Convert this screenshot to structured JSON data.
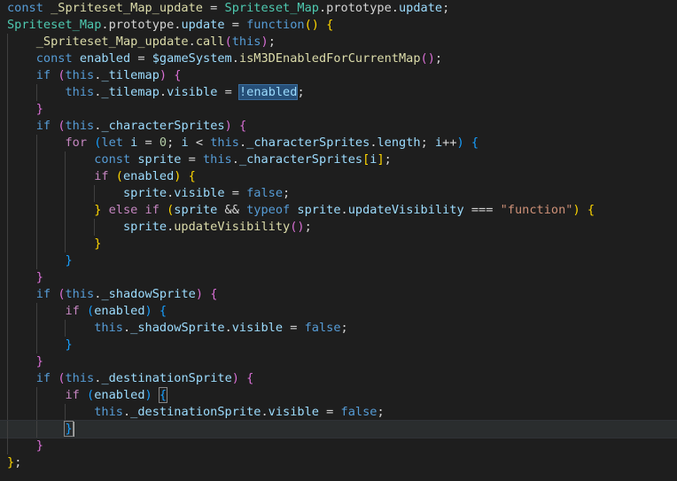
{
  "editor": {
    "language": "javascript",
    "theme_colors": {
      "background": "#1e1e1e",
      "keyword": "#569cd6",
      "class": "#4ec9b0",
      "variable": "#9cdcfe",
      "function": "#dcdcaa",
      "string": "#ce9178",
      "number": "#b5cea8",
      "bracket_1": "#ffd700",
      "bracket_2": "#da70d6",
      "bracket_3": "#179fff",
      "selection": "#264f78"
    },
    "lines": [
      {
        "indent": 0,
        "tokens": [
          {
            "t": "const ",
            "c": "kw"
          },
          {
            "t": "_Spriteset_Map_update",
            "c": "fn"
          },
          {
            "t": " = ",
            "c": "op"
          },
          {
            "t": "Spriteset_Map",
            "c": "cls"
          },
          {
            "t": ".prototype.",
            "c": "plain"
          },
          {
            "t": "update",
            "c": "var"
          },
          {
            "t": ";",
            "c": "op"
          }
        ]
      },
      {
        "indent": 0,
        "tokens": [
          {
            "t": "Spriteset_Map",
            "c": "cls"
          },
          {
            "t": ".prototype.",
            "c": "plain"
          },
          {
            "t": "update",
            "c": "var"
          },
          {
            "t": " = ",
            "c": "op"
          },
          {
            "t": "function",
            "c": "kw"
          },
          {
            "t": "()",
            "c": "b1"
          },
          {
            "t": " ",
            "c": "op"
          },
          {
            "t": "{",
            "c": "b1"
          }
        ]
      },
      {
        "indent": 1,
        "tokens": [
          {
            "t": "_Spriteset_Map_update",
            "c": "fn"
          },
          {
            "t": ".",
            "c": "plain"
          },
          {
            "t": "call",
            "c": "fn"
          },
          {
            "t": "(",
            "c": "b2"
          },
          {
            "t": "this",
            "c": "kw"
          },
          {
            "t": ")",
            "c": "b2"
          },
          {
            "t": ";",
            "c": "op"
          }
        ]
      },
      {
        "indent": 1,
        "tokens": [
          {
            "t": "const ",
            "c": "kw"
          },
          {
            "t": "enabled",
            "c": "var"
          },
          {
            "t": " = ",
            "c": "op"
          },
          {
            "t": "$gameSystem",
            "c": "var"
          },
          {
            "t": ".",
            "c": "plain"
          },
          {
            "t": "isM3DEnabledForCurrentMap",
            "c": "fn"
          },
          {
            "t": "()",
            "c": "b2"
          },
          {
            "t": ";",
            "c": "op"
          }
        ]
      },
      {
        "indent": 1,
        "tokens": [
          {
            "t": "if ",
            "c": "kw"
          },
          {
            "t": "(",
            "c": "b2"
          },
          {
            "t": "this",
            "c": "kw"
          },
          {
            "t": ".",
            "c": "plain"
          },
          {
            "t": "_tilemap",
            "c": "var"
          },
          {
            "t": ")",
            "c": "b2"
          },
          {
            "t": " ",
            "c": "op"
          },
          {
            "t": "{",
            "c": "b2"
          }
        ]
      },
      {
        "indent": 2,
        "tokens": [
          {
            "t": "this",
            "c": "kw"
          },
          {
            "t": ".",
            "c": "plain"
          },
          {
            "t": "_tilemap",
            "c": "var"
          },
          {
            "t": ".",
            "c": "plain"
          },
          {
            "t": "visible",
            "c": "var"
          },
          {
            "t": " = ",
            "c": "op"
          },
          {
            "t": "!enabled",
            "c": "var",
            "sel": true
          },
          {
            "t": ";",
            "c": "op"
          }
        ]
      },
      {
        "indent": 1,
        "tokens": [
          {
            "t": "}",
            "c": "b2"
          }
        ]
      },
      {
        "indent": 1,
        "tokens": [
          {
            "t": "if ",
            "c": "kw"
          },
          {
            "t": "(",
            "c": "b2"
          },
          {
            "t": "this",
            "c": "kw"
          },
          {
            "t": ".",
            "c": "plain"
          },
          {
            "t": "_characterSprites",
            "c": "var"
          },
          {
            "t": ")",
            "c": "b2"
          },
          {
            "t": " ",
            "c": "op"
          },
          {
            "t": "{",
            "c": "b2"
          }
        ]
      },
      {
        "indent": 2,
        "tokens": [
          {
            "t": "for ",
            "c": "kwc"
          },
          {
            "t": "(",
            "c": "b3"
          },
          {
            "t": "let ",
            "c": "kw"
          },
          {
            "t": "i",
            "c": "var"
          },
          {
            "t": " = ",
            "c": "op"
          },
          {
            "t": "0",
            "c": "num"
          },
          {
            "t": "; ",
            "c": "op"
          },
          {
            "t": "i",
            "c": "var"
          },
          {
            "t": " < ",
            "c": "op"
          },
          {
            "t": "this",
            "c": "kw"
          },
          {
            "t": ".",
            "c": "plain"
          },
          {
            "t": "_characterSprites",
            "c": "var"
          },
          {
            "t": ".",
            "c": "plain"
          },
          {
            "t": "length",
            "c": "var"
          },
          {
            "t": "; ",
            "c": "op"
          },
          {
            "t": "i",
            "c": "var"
          },
          {
            "t": "++",
            "c": "op"
          },
          {
            "t": ")",
            "c": "b3"
          },
          {
            "t": " ",
            "c": "op"
          },
          {
            "t": "{",
            "c": "b3"
          }
        ]
      },
      {
        "indent": 3,
        "tokens": [
          {
            "t": "const ",
            "c": "kw"
          },
          {
            "t": "sprite",
            "c": "var"
          },
          {
            "t": " = ",
            "c": "op"
          },
          {
            "t": "this",
            "c": "kw"
          },
          {
            "t": ".",
            "c": "plain"
          },
          {
            "t": "_characterSprites",
            "c": "var"
          },
          {
            "t": "[",
            "c": "b1"
          },
          {
            "t": "i",
            "c": "var"
          },
          {
            "t": "]",
            "c": "b1"
          },
          {
            "t": ";",
            "c": "op"
          }
        ]
      },
      {
        "indent": 3,
        "tokens": [
          {
            "t": "if ",
            "c": "kwc"
          },
          {
            "t": "(",
            "c": "b1"
          },
          {
            "t": "enabled",
            "c": "var"
          },
          {
            "t": ")",
            "c": "b1"
          },
          {
            "t": " ",
            "c": "op"
          },
          {
            "t": "{",
            "c": "b1"
          }
        ]
      },
      {
        "indent": 4,
        "tokens": [
          {
            "t": "sprite",
            "c": "var"
          },
          {
            "t": ".",
            "c": "plain"
          },
          {
            "t": "visible",
            "c": "var"
          },
          {
            "t": " = ",
            "c": "op"
          },
          {
            "t": "false",
            "c": "kw"
          },
          {
            "t": ";",
            "c": "op"
          }
        ]
      },
      {
        "indent": 3,
        "tokens": [
          {
            "t": "}",
            "c": "b1"
          },
          {
            "t": " ",
            "c": "op"
          },
          {
            "t": "else ",
            "c": "kwc"
          },
          {
            "t": "if ",
            "c": "kwc"
          },
          {
            "t": "(",
            "c": "b1"
          },
          {
            "t": "sprite",
            "c": "var"
          },
          {
            "t": " && ",
            "c": "op"
          },
          {
            "t": "typeof ",
            "c": "kw"
          },
          {
            "t": "sprite",
            "c": "var"
          },
          {
            "t": ".",
            "c": "plain"
          },
          {
            "t": "updateVisibility",
            "c": "var"
          },
          {
            "t": " === ",
            "c": "op"
          },
          {
            "t": "\"function\"",
            "c": "str"
          },
          {
            "t": ")",
            "c": "b1"
          },
          {
            "t": " ",
            "c": "op"
          },
          {
            "t": "{",
            "c": "b1"
          }
        ]
      },
      {
        "indent": 4,
        "tokens": [
          {
            "t": "sprite",
            "c": "var"
          },
          {
            "t": ".",
            "c": "plain"
          },
          {
            "t": "updateVisibility",
            "c": "fn"
          },
          {
            "t": "()",
            "c": "b2"
          },
          {
            "t": ";",
            "c": "op"
          }
        ]
      },
      {
        "indent": 3,
        "tokens": [
          {
            "t": "}",
            "c": "b1"
          }
        ]
      },
      {
        "indent": 2,
        "tokens": [
          {
            "t": "}",
            "c": "b3"
          }
        ]
      },
      {
        "indent": 1,
        "tokens": [
          {
            "t": "}",
            "c": "b2"
          }
        ]
      },
      {
        "indent": 1,
        "tokens": [
          {
            "t": "if ",
            "c": "kw"
          },
          {
            "t": "(",
            "c": "b2"
          },
          {
            "t": "this",
            "c": "kw"
          },
          {
            "t": ".",
            "c": "plain"
          },
          {
            "t": "_shadowSprite",
            "c": "var"
          },
          {
            "t": ")",
            "c": "b2"
          },
          {
            "t": " ",
            "c": "op"
          },
          {
            "t": "{",
            "c": "b2"
          }
        ]
      },
      {
        "indent": 2,
        "tokens": [
          {
            "t": "if ",
            "c": "kwc"
          },
          {
            "t": "(",
            "c": "b3"
          },
          {
            "t": "enabled",
            "c": "var"
          },
          {
            "t": ")",
            "c": "b3"
          },
          {
            "t": " ",
            "c": "op"
          },
          {
            "t": "{",
            "c": "b3"
          }
        ]
      },
      {
        "indent": 3,
        "tokens": [
          {
            "t": "this",
            "c": "kw"
          },
          {
            "t": ".",
            "c": "plain"
          },
          {
            "t": "_shadowSprite",
            "c": "var"
          },
          {
            "t": ".",
            "c": "plain"
          },
          {
            "t": "visible",
            "c": "var"
          },
          {
            "t": " = ",
            "c": "op"
          },
          {
            "t": "false",
            "c": "kw"
          },
          {
            "t": ";",
            "c": "op"
          }
        ]
      },
      {
        "indent": 2,
        "tokens": [
          {
            "t": "}",
            "c": "b3"
          }
        ]
      },
      {
        "indent": 1,
        "tokens": [
          {
            "t": "}",
            "c": "b2"
          }
        ]
      },
      {
        "indent": 1,
        "tokens": [
          {
            "t": "if ",
            "c": "kw"
          },
          {
            "t": "(",
            "c": "b2"
          },
          {
            "t": "this",
            "c": "kw"
          },
          {
            "t": ".",
            "c": "plain"
          },
          {
            "t": "_destinationSprite",
            "c": "var"
          },
          {
            "t": ")",
            "c": "b2"
          },
          {
            "t": " ",
            "c": "op"
          },
          {
            "t": "{",
            "c": "b2"
          }
        ]
      },
      {
        "indent": 2,
        "tokens": [
          {
            "t": "if ",
            "c": "kwc"
          },
          {
            "t": "(",
            "c": "b3"
          },
          {
            "t": "enabled",
            "c": "var"
          },
          {
            "t": ")",
            "c": "b3"
          },
          {
            "t": " ",
            "c": "op"
          },
          {
            "t": "{",
            "c": "b3",
            "match": true
          }
        ]
      },
      {
        "indent": 3,
        "tokens": [
          {
            "t": "this",
            "c": "kw"
          },
          {
            "t": ".",
            "c": "plain"
          },
          {
            "t": "_destinationSprite",
            "c": "var"
          },
          {
            "t": ".",
            "c": "plain"
          },
          {
            "t": "visible",
            "c": "var"
          },
          {
            "t": " = ",
            "c": "op"
          },
          {
            "t": "false",
            "c": "kw"
          },
          {
            "t": ";",
            "c": "op"
          }
        ]
      },
      {
        "indent": 2,
        "current": true,
        "cursor_after": true,
        "tokens": [
          {
            "t": "}",
            "c": "b3",
            "match": true
          }
        ]
      },
      {
        "indent": 1,
        "tokens": [
          {
            "t": "}",
            "c": "b2"
          }
        ]
      },
      {
        "indent": 0,
        "tokens": [
          {
            "t": "}",
            "c": "b1"
          },
          {
            "t": ";",
            "c": "op"
          }
        ]
      }
    ]
  }
}
